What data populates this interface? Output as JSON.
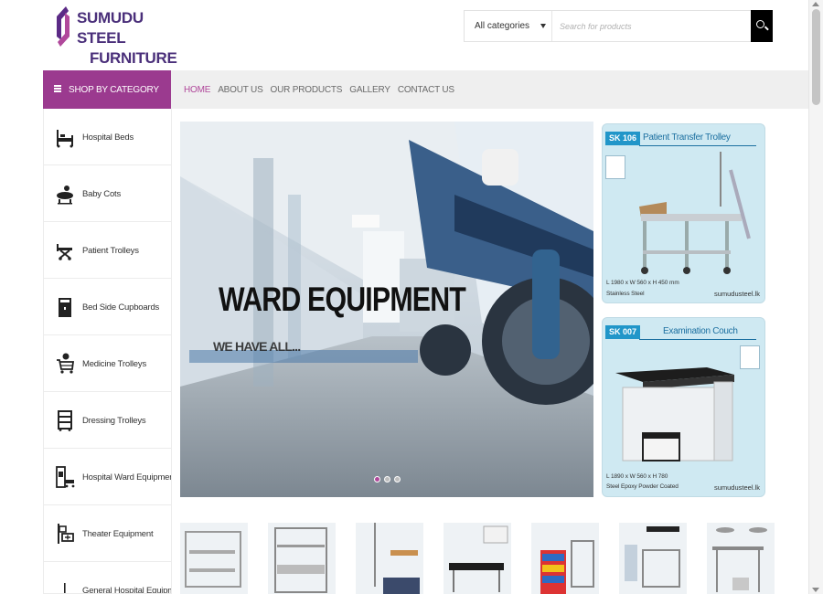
{
  "header": {
    "logo_line1": "SUMUDU STEEL",
    "logo_line2": "FURNITURE",
    "search": {
      "category_selected": "All categories",
      "placeholder": "Search for products"
    }
  },
  "category_menu": {
    "label": "SHOP BY CATEGORY",
    "icon": "menu-icon"
  },
  "nav": {
    "items": [
      "HOME",
      "ABOUT US",
      "OUR PRODUCTS",
      "GALLERY",
      "CONTACT US"
    ],
    "active_index": 0
  },
  "sidebar": {
    "items": [
      {
        "label": "Hospital Beds",
        "icon": "hospital-bed-icon"
      },
      {
        "label": "Baby Cots",
        "icon": "baby-cot-icon"
      },
      {
        "label": "Patient Trolleys",
        "icon": "patient-trolley-icon"
      },
      {
        "label": "Bed Side Cupboards",
        "icon": "cupboard-icon"
      },
      {
        "label": "Medicine Trolleys",
        "icon": "medicine-trolley-icon"
      },
      {
        "label": "Dressing Trolleys",
        "icon": "dressing-trolley-icon"
      },
      {
        "label": "Hospital Ward Equipment",
        "icon": "ward-equipment-icon"
      },
      {
        "label": "Theater Equipment",
        "icon": "theater-equipment-icon"
      },
      {
        "label": "General Hospital Equipment",
        "icon": "general-equipment-icon"
      }
    ]
  },
  "hero": {
    "title": "WARD EQUIPMENT",
    "subtitle": "WE HAVE ALL...",
    "slides": 3,
    "active_slide": 0
  },
  "cards": [
    {
      "code_prefix": "SK",
      "code_number": "106",
      "title": "Patient Transfer Trolley",
      "dim_line1": "L 1980 x W 560 x H 450 mm",
      "dim_line2": "Stainless Steel",
      "site": "sumudusteel.lk"
    },
    {
      "code_prefix": "SK",
      "code_number": "007",
      "title": "Examination Couch",
      "dim_line1": "L 1890 x W 560 x H 780",
      "dim_line2": "Steel Epoxy Powder Coated",
      "site": "sumudusteel.lk"
    }
  ],
  "colors": {
    "brand_purple": "#9b3a8f",
    "nav_active": "#b0489b",
    "logo_text": "#4a2f7a",
    "card_bg": "#cfe9f2",
    "card_code_bg": "#2196c9"
  }
}
